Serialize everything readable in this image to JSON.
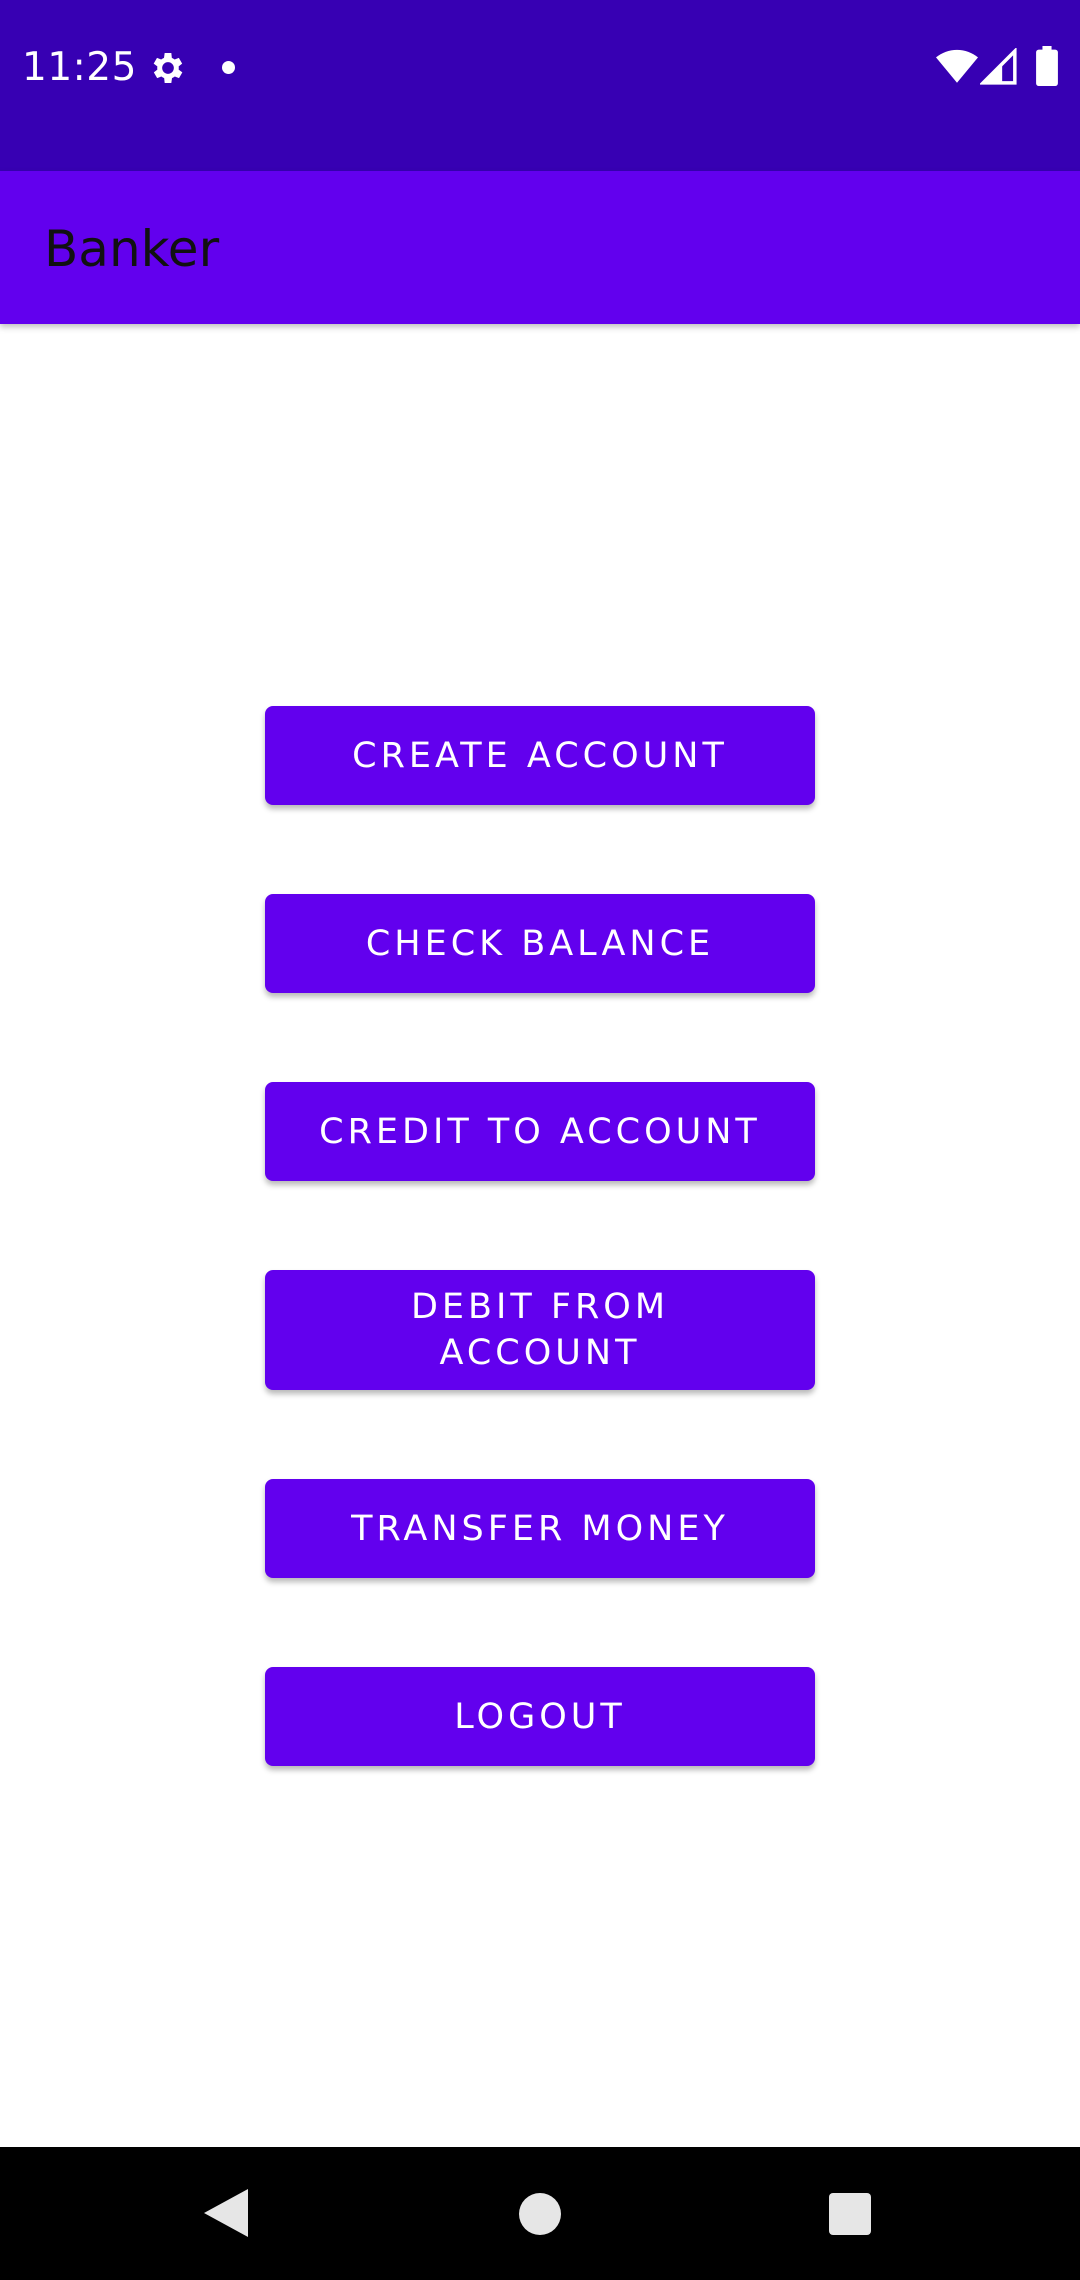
{
  "status_bar": {
    "time": "11:25",
    "icons": [
      "gear-icon",
      "notification-dot-icon",
      "wifi-icon",
      "signal-icon",
      "battery-icon"
    ]
  },
  "app_bar": {
    "title": "Banker"
  },
  "buttons": {
    "create_account": "CREATE ACCOUNT",
    "check_balance": "CHECK BALANCE",
    "credit_to_account": "CREDIT TO ACCOUNT",
    "debit_from_account": "DEBIT FROM ACCOUNT",
    "transfer_money": "TRANSFER MONEY",
    "logout": "LOGOUT"
  },
  "nav_bar": {
    "icons": [
      "back-icon",
      "home-icon",
      "recents-icon"
    ]
  },
  "colors": {
    "status_bar": "#3700b3",
    "primary": "#6200ee",
    "background": "#ffffff",
    "nav_bar": "#000000"
  }
}
